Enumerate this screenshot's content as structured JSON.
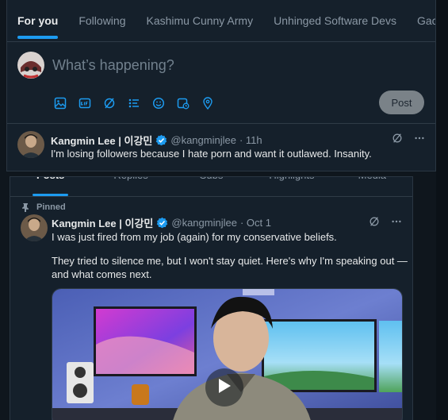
{
  "feed_tabs": [
    "For you",
    "Following",
    "Kashimu Cunny Army",
    "Unhinged Software Devs",
    "Gacha G"
  ],
  "composer": {
    "placeholder": "What’s happening?",
    "post_label": "Post"
  },
  "tweet_top": {
    "name": "Kangmin Lee | 이강민",
    "handle": "@kangminjlee",
    "time": "· 11h",
    "text": "I'm losing followers because I hate porn and want it outlawed. Insanity."
  },
  "profile_tabs": [
    "Posts",
    "Replies",
    "Subs",
    "Highlights",
    "Media"
  ],
  "pinned_label": "Pinned",
  "tweet_pinned": {
    "name": "Kangmin Lee | 이강민",
    "handle": "@kangminjlee",
    "time": "· Oct 1",
    "line1": "I was just fired from my job (again) for my conservative beliefs.",
    "line2": "They tried to silence me, but I won't stay quiet. Here's why I'm speaking out —",
    "line3": "and what comes next."
  },
  "colors": {
    "accent": "#1d9bf0",
    "background": "#15202b",
    "verified": "#1d9bf0"
  },
  "icons": [
    "image-icon",
    "gif-icon",
    "grok-icon",
    "poll-icon",
    "emoji-icon",
    "schedule-icon",
    "location-icon",
    "grok-icon",
    "more-icon",
    "play-icon",
    "pin-icon",
    "verified-icon"
  ]
}
